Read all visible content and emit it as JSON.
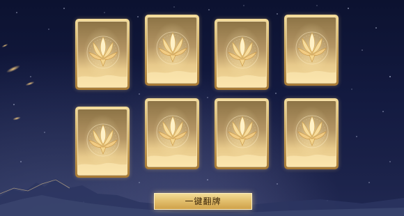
{
  "actions": {
    "flip_all_label": "一键翻牌"
  },
  "cards": [
    {
      "id": "card-1",
      "state": "face-down"
    },
    {
      "id": "card-2",
      "state": "face-down"
    },
    {
      "id": "card-3",
      "state": "face-down"
    },
    {
      "id": "card-4",
      "state": "face-down"
    },
    {
      "id": "card-5",
      "state": "face-down"
    },
    {
      "id": "card-6",
      "state": "face-down"
    },
    {
      "id": "card-7",
      "state": "face-down"
    },
    {
      "id": "card-8",
      "state": "face-down"
    }
  ],
  "icons": {
    "card_emblem": "golden-lotus-emblem-icon"
  },
  "colors": {
    "background": "#131a40",
    "card_gold": "#d9b46a",
    "button_gold": "#e1bd6a",
    "button_text": "#3b2508"
  }
}
